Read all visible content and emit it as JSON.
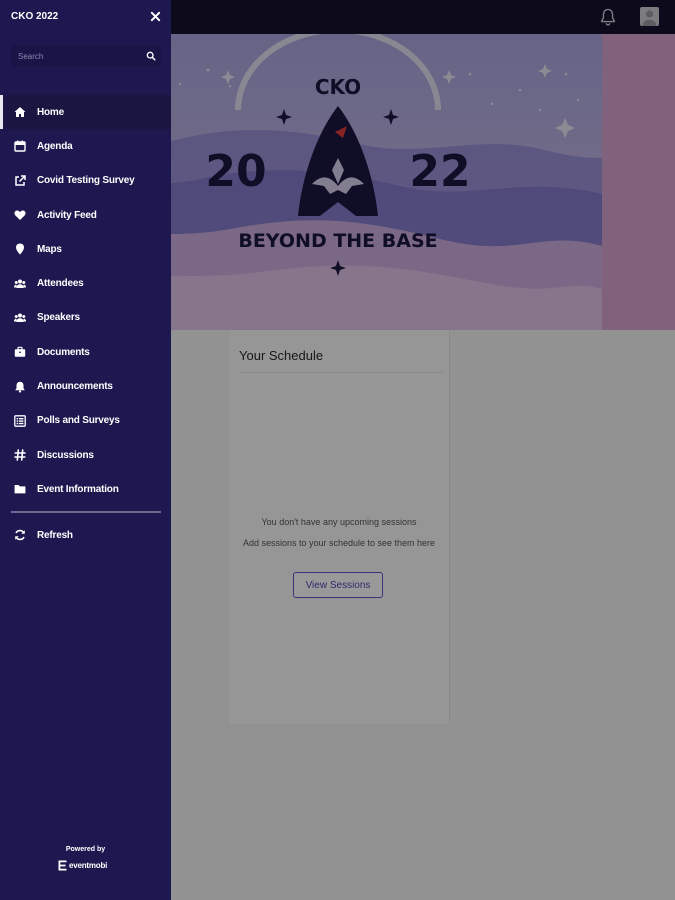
{
  "header": {
    "notifications_icon": "bell-icon",
    "profile_icon": "user-avatar-icon"
  },
  "hero": {
    "brand": "CKO",
    "year_left": "20",
    "year_right": "22",
    "tagline": "BEYOND THE BASE"
  },
  "schedule": {
    "title": "Your Schedule",
    "empty_line1": "You don't have any upcoming sessions",
    "empty_line2": "Add sessions to your schedule to see them here",
    "view_button": "View Sessions"
  },
  "drawer": {
    "title": "CKO 2022",
    "close_icon": "close-icon",
    "search": {
      "placeholder": "Search",
      "value": ""
    },
    "items": [
      {
        "label": "Home",
        "icon": "home-icon",
        "active": true
      },
      {
        "label": "Agenda",
        "icon": "calendar-icon"
      },
      {
        "label": "Covid Testing Survey",
        "icon": "external-link-icon"
      },
      {
        "label": "Activity Feed",
        "icon": "heart-icon"
      },
      {
        "label": "Maps",
        "icon": "map-pin-icon"
      },
      {
        "label": "Attendees",
        "icon": "users-icon"
      },
      {
        "label": "Speakers",
        "icon": "users-icon"
      },
      {
        "label": "Documents",
        "icon": "briefcase-icon"
      },
      {
        "label": "Announcements",
        "icon": "bell-icon"
      },
      {
        "label": "Polls and Surveys",
        "icon": "poll-icon"
      },
      {
        "label": "Discussions",
        "icon": "hashtag-icon"
      },
      {
        "label": "Event Information",
        "icon": "folder-icon"
      }
    ],
    "refresh_label": "Refresh",
    "powered_by": "Powered by",
    "brand_name": "eventmobi"
  },
  "colors": {
    "drawer_bg": "#1e1850",
    "topbar_bg": "#16122e",
    "accent": "#5b56c9",
    "hero_rocket": "#1c1740",
    "hero_accent_red": "#e33b3b"
  }
}
